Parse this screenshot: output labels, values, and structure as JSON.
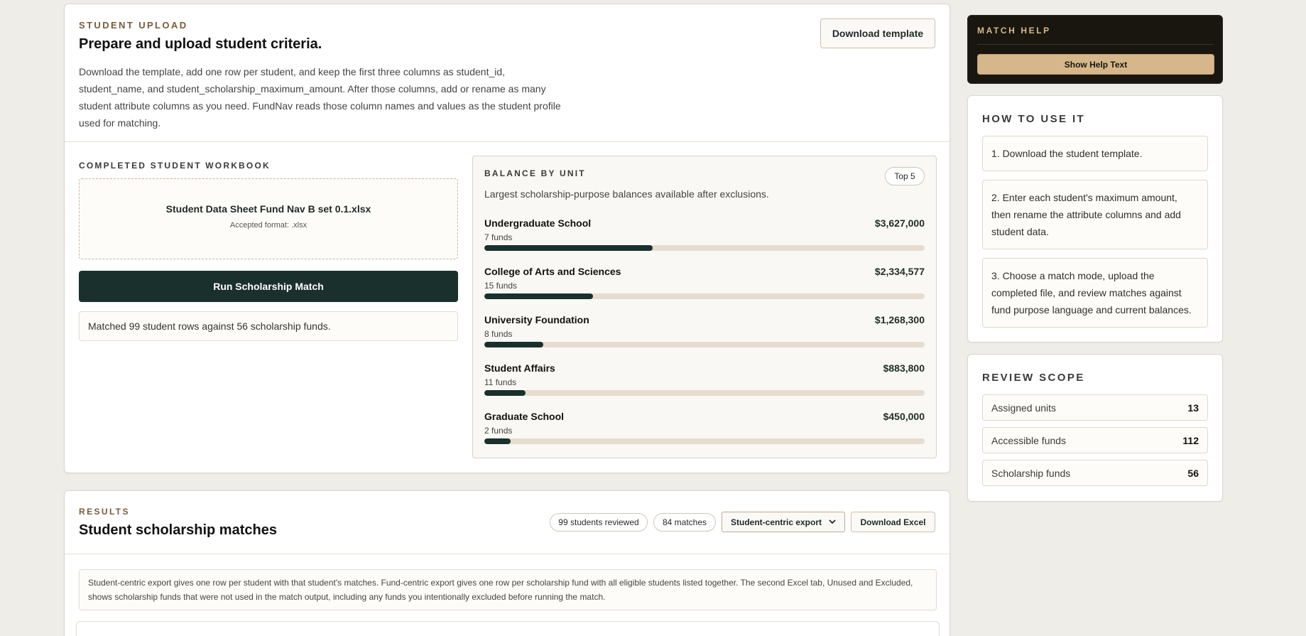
{
  "upload": {
    "eyebrow": "STUDENT UPLOAD",
    "title": "Prepare and upload student criteria.",
    "description": "Download the template, add one row per student, and keep the first three columns as student_id, student_name, and student_scholarship_maximum_amount. After those columns, add or rename as many student attribute columns as you need. FundNav reads those column names and values as the student profile used for matching.",
    "download_template_label": "Download template",
    "workbook_label": "COMPLETED STUDENT WORKBOOK",
    "file_name": "Student Data Sheet Fund Nav B set 0.1.xlsx",
    "accepted_format": "Accepted format: .xlsx",
    "run_label": "Run Scholarship Match",
    "status": "Matched 99 student rows against 56 scholarship funds."
  },
  "balance": {
    "label": "BALANCE BY UNIT",
    "badge": "Top 5",
    "description": "Largest scholarship-purpose balances available after exclusions.",
    "units": [
      {
        "name": "Undergraduate School",
        "amount": "$3,627,000",
        "funds": "7 funds",
        "share": 0.383
      },
      {
        "name": "College of Arts and Sciences",
        "amount": "$2,334,577",
        "funds": "15 funds",
        "share": 0.246
      },
      {
        "name": "University Foundation",
        "amount": "$1,268,300",
        "funds": "8 funds",
        "share": 0.134
      },
      {
        "name": "Student Affairs",
        "amount": "$883,800",
        "funds": "11 funds",
        "share": 0.093
      },
      {
        "name": "Graduate School",
        "amount": "$450,000",
        "funds": "2 funds",
        "share": 0.059
      }
    ]
  },
  "results": {
    "eyebrow": "RESULTS",
    "title": "Student scholarship matches",
    "students_reviewed": "99 students reviewed",
    "matches": "84 matches",
    "export_mode": "Student-centric export",
    "download_excel_label": "Download Excel",
    "note": "Student-centric export gives one row per student with that student's matches. Fund-centric export gives one row per scholarship fund with all eligible students listed together. The second Excel tab, Unused and Excluded, shows scholarship funds that were not used in the match output, including any funds you intentionally excluded before running the match."
  },
  "help": {
    "label": "MATCH HELP",
    "button_label": "Show Help Text"
  },
  "howto": {
    "label": "HOW TO USE IT",
    "steps": [
      "1. Download the student template.",
      "2. Enter each student's maximum amount, then rename the attribute columns and add student data.",
      "3. Choose a match mode, upload the completed file, and review matches against fund purpose language and current balances."
    ]
  },
  "scope": {
    "label": "REVIEW SCOPE",
    "rows": [
      {
        "label": "Assigned units",
        "value": "13"
      },
      {
        "label": "Accessible funds",
        "value": "112"
      },
      {
        "label": "Scholarship funds",
        "value": "56"
      }
    ]
  },
  "icons": {
    "select_caret": "chevron-down-icon"
  },
  "colors": {
    "accent_dark": "#1a302c",
    "accent_gold": "#d6b78b",
    "eyebrow_brown": "#7a5a3a",
    "page_bg": "#efede8"
  }
}
